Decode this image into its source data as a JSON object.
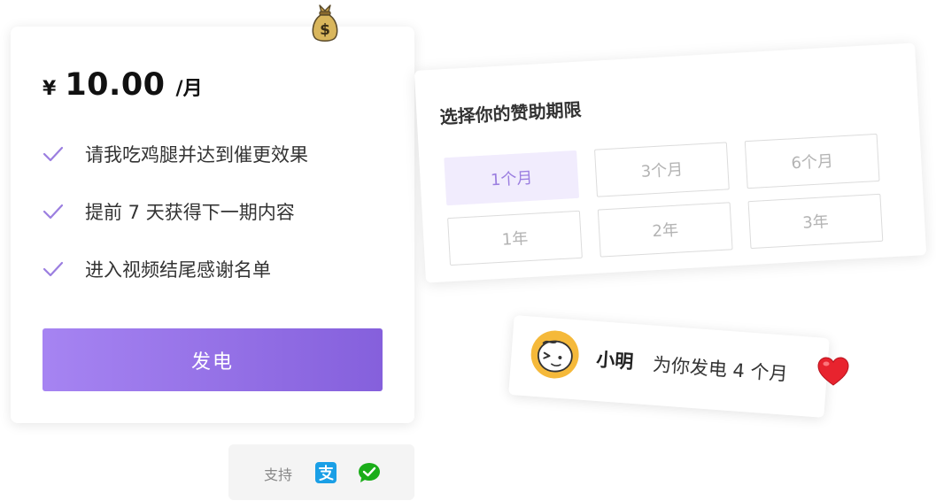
{
  "price_card": {
    "currency": "¥",
    "amount": "10.00",
    "unit": "/月",
    "benefits": [
      "请我吃鸡腿并达到催更效果",
      "提前 7 天获得下一期内容",
      "进入视频结尾感谢名单"
    ],
    "charge_button_label": "发电"
  },
  "payment_support": {
    "label": "支持",
    "icons": [
      "alipay-icon",
      "wechat-pay-icon"
    ]
  },
  "period_selector": {
    "title": "选择你的赞助期限",
    "options": [
      "1个月",
      "3个月",
      "6个月",
      "1年",
      "2年",
      "3年"
    ],
    "selected": "1个月"
  },
  "sponsor_notice": {
    "name": "小明",
    "message": "为你发电 4 个月"
  },
  "colors": {
    "accent_start": "#a684f2",
    "accent_end": "#8560dc",
    "check": "#9b7ee0",
    "selected_bg": "#f1ecfd",
    "avatar_bg": "#f5b93a",
    "heart": "#e8232e"
  },
  "decorations": [
    "money-bag-icon",
    "heart-icon",
    "avatar"
  ]
}
